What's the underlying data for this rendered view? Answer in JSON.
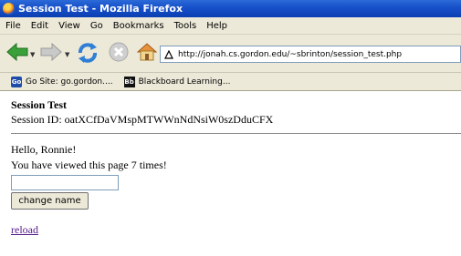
{
  "window": {
    "title": "Session Test - Mozilla Firefox"
  },
  "menu": [
    "File",
    "Edit",
    "View",
    "Go",
    "Bookmarks",
    "Tools",
    "Help"
  ],
  "address": {
    "url": "http://jonah.cs.gordon.edu/~sbrinton/session_test.php"
  },
  "bookmarks": [
    {
      "icon": "go-site-icon",
      "label": "Go Site: go.gordon...."
    },
    {
      "icon": "blackboard-icon",
      "label": "Blackboard Learning..."
    }
  ],
  "page": {
    "title": "Session Test",
    "session_id": "Session ID: oatXCfDaVMspMTWWnNdNsiW0szDduCFX",
    "greeting": "Hello, Ronnie!",
    "views": "You have viewed this page 7 times!",
    "name_input_value": "",
    "change_button": "change name",
    "reload_link": "reload"
  },
  "icons": {
    "go_site_icon_text": "Go",
    "blackboard_icon_text": "Bb"
  }
}
